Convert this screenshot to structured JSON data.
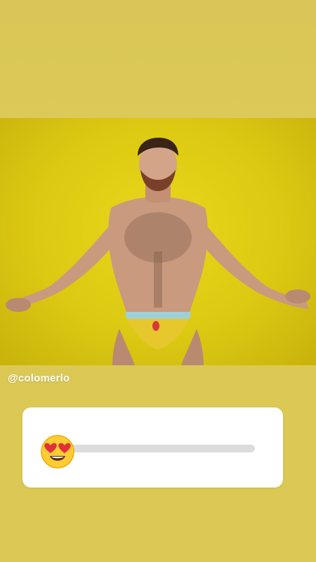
{
  "story": {
    "username": "@colomerlo"
  },
  "slider": {
    "emoji": "smiling-face-with-heart-eyes",
    "value_fraction": 0.02,
    "track_color": "#dcdcdc",
    "fill_color": "#f0206a"
  },
  "colors": {
    "background": "#dcc955",
    "photo_backdrop": "#e2d115"
  }
}
